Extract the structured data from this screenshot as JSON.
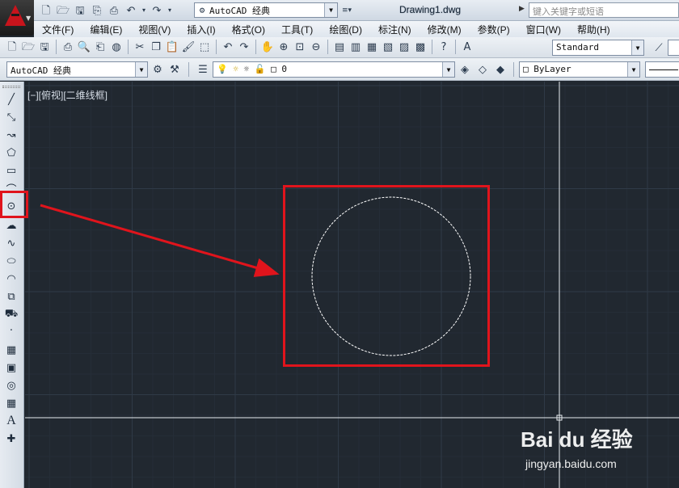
{
  "titlebar": {
    "workspace": "AutoCAD 经典",
    "document": "Drawing1.dwg",
    "search_placeholder": "键入关键字或短语"
  },
  "menu": [
    "文件(F)",
    "编辑(E)",
    "视图(V)",
    "插入(I)",
    "格式(O)",
    "工具(T)",
    "绘图(D)",
    "标注(N)",
    "修改(M)",
    "参数(P)",
    "窗口(W)",
    "帮助(H)"
  ],
  "toolbar": {
    "text_style": "Standard",
    "workspace_combo": "AutoCAD 经典",
    "layer": "0",
    "color": "ByLayer"
  },
  "viewport": {
    "label": "[−][俯视][二维线框]"
  },
  "palette_tools": [
    "line-icon",
    "construction-line-icon",
    "polyline-icon",
    "polygon-icon",
    "rectangle-icon",
    "arc-icon",
    "circle-icon",
    "revision-cloud-icon",
    "spline-icon",
    "ellipse-icon",
    "ellipse-arc-icon",
    "insert-block-icon",
    "make-block-icon",
    "point-icon",
    "hatch-icon",
    "gradient-icon",
    "region-icon",
    "table-icon",
    "multiline-text-icon",
    "add-selected-icon"
  ],
  "watermark": {
    "logo": "Bai du 经验",
    "url": "jingyan.baidu.com"
  },
  "colors": {
    "canvas": "#212830",
    "highlight": "#e0141c",
    "grid_major": "#2f3a47",
    "circle": "#ffffff"
  }
}
